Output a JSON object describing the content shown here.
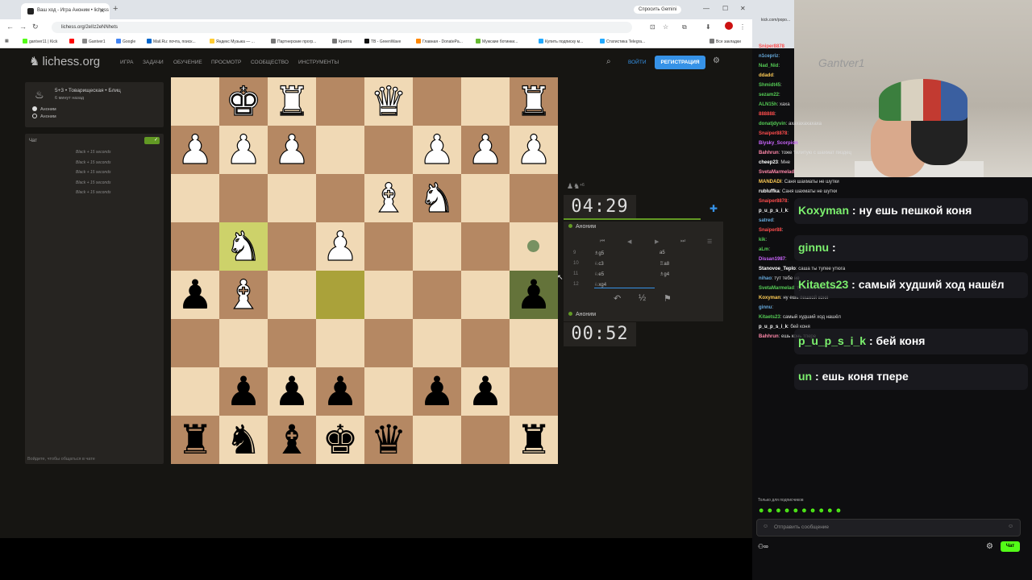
{
  "browser": {
    "tab_title": "Ваш ход - Игра Аноним • lichess",
    "gemini_label": "Спросить Gemini",
    "url": "lichess.org/2eIIz2eNNhets",
    "bookmarks": [
      "gantver11 | Kick",
      "Gantver1",
      "Google",
      "Mail.Ru: почта, поиск...",
      "Яндекс Музыка — ...",
      "Партнерские прогр...",
      "Криптa",
      "ТВ - GreenWave",
      "Главная - DonatePa...",
      "Мужские ботинки...",
      "Купить подписку м...",
      "Статистика Telegra...",
      "Все закладки"
    ]
  },
  "site": {
    "logo": "lichess.org",
    "nav": [
      "Игра",
      "Задачи",
      "Обучение",
      "Просмотр",
      "Сообщество",
      "Инструменты"
    ],
    "login": "ВОЙТИ",
    "register": "РЕГИСТРАЦИЯ"
  },
  "game_info": {
    "mode": "5+3 • Товарищеская • Блиц",
    "time_ago": "6 минут назад",
    "player_white": "Аноним",
    "player_black": "Аноним"
  },
  "lichess_chat": {
    "title": "Чат",
    "lines": [
      "Black + 15 seconds",
      "Black + 15 seconds",
      "Black + 15 seconds",
      "Black + 15 seconds",
      "Black + 15 seconds"
    ],
    "login_prompt": "Войдите, чтобы общаться в чате"
  },
  "board": {
    "pieces": [
      {
        "sq": "b8",
        "c": "w",
        "p": "♚"
      },
      {
        "sq": "c8",
        "c": "w",
        "p": "♜"
      },
      {
        "sq": "e8",
        "c": "w",
        "p": "♛"
      },
      {
        "sq": "h8",
        "c": "w",
        "p": "♜"
      },
      {
        "sq": "a7",
        "c": "w",
        "p": "♟"
      },
      {
        "sq": "b7",
        "c": "w",
        "p": "♟"
      },
      {
        "sq": "c7",
        "c": "w",
        "p": "♟"
      },
      {
        "sq": "f7",
        "c": "w",
        "p": "♟"
      },
      {
        "sq": "g7",
        "c": "w",
        "p": "♟"
      },
      {
        "sq": "h7",
        "c": "w",
        "p": "♟"
      },
      {
        "sq": "e6",
        "c": "w",
        "p": "♝"
      },
      {
        "sq": "f6",
        "c": "w",
        "p": "♞"
      },
      {
        "sq": "b5",
        "c": "w",
        "p": "♞"
      },
      {
        "sq": "d5",
        "c": "w",
        "p": "♟"
      },
      {
        "sq": "a4",
        "c": "b",
        "p": "♟"
      },
      {
        "sq": "b4",
        "c": "w",
        "p": "♝"
      },
      {
        "sq": "h4",
        "c": "b",
        "p": "♟"
      },
      {
        "sq": "b2",
        "c": "b",
        "p": "♟"
      },
      {
        "sq": "c2",
        "c": "b",
        "p": "♟"
      },
      {
        "sq": "d2",
        "c": "b",
        "p": "♟"
      },
      {
        "sq": "f2",
        "c": "b",
        "p": "♟"
      },
      {
        "sq": "g2",
        "c": "b",
        "p": "♟"
      },
      {
        "sq": "a1",
        "c": "b",
        "p": "♜"
      },
      {
        "sq": "b1",
        "c": "b",
        "p": "♞"
      },
      {
        "sq": "c1",
        "c": "b",
        "p": "♝"
      },
      {
        "sq": "d1",
        "c": "b",
        "p": "♚"
      },
      {
        "sq": "e1",
        "c": "b",
        "p": "♛"
      },
      {
        "sq": "h1",
        "c": "b",
        "p": "♜"
      }
    ],
    "highlights": [
      "b5",
      "d4"
    ],
    "check_square": "h4",
    "light_color": "#f0d9b5",
    "dark_color": "#b58863"
  },
  "clocks": {
    "top": "04:29",
    "bottom": "00:52",
    "top_player": "Аноним",
    "bottom_player": "Аноним",
    "material_diff": "+6"
  },
  "moves": [
    {
      "n": "9",
      "w": "♗g5",
      "b": "a5"
    },
    {
      "n": "10",
      "w": "♘c3",
      "b": "♖a8"
    },
    {
      "n": "11",
      "w": "♘e5",
      "b": "♗g4"
    },
    {
      "n": "12",
      "w": "♘xg4",
      "b": ""
    }
  ],
  "draw_label": "½",
  "twitch_chat": [
    {
      "u": "Sniper8878",
      "c": "#ff4d4d",
      "t": ""
    },
    {
      "u": "n1cepriz",
      "c": "#6ad",
      "t": ""
    },
    {
      "u": "Nad_Nid",
      "c": "#5c5",
      "t": ""
    },
    {
      "u": "ddadd",
      "c": "#fc5",
      "t": ""
    },
    {
      "u": "Shmidt45",
      "c": "#5c5",
      "t": ""
    },
    {
      "u": "sezam22",
      "c": "#5c5",
      "t": ""
    },
    {
      "u": "ALN15h",
      "c": "#5c5",
      "t": "хаха"
    },
    {
      "u": "888888",
      "c": "#ff4d4d",
      "t": ""
    },
    {
      "u": "donatjdyvin",
      "c": "#5c5",
      "t": "ахахахахахаха"
    },
    {
      "u": "Snaiper8878",
      "c": "#ff4d4d",
      "t": ""
    },
    {
      "u": "Biysky_Scorpion",
      "c": "#c6f",
      "t": ""
    },
    {
      "u": "Bahhrun",
      "c": "#f8a",
      "t": "тоже тилитую с шахмат пиздец"
    },
    {
      "u": "cheep23",
      "c": "#fff",
      "t": "Мне"
    },
    {
      "u": "SvetaMarmelad",
      "c": "#f8a",
      "t": ""
    },
    {
      "u": "MANDADI",
      "c": "#fc5",
      "t": "Саня шахматы не шутки"
    },
    {
      "u": "rubluffka",
      "c": "#fff",
      "t": "Саня шахматы не шутки"
    },
    {
      "u": "Snaiper8878",
      "c": "#ff4d4d",
      "t": ""
    },
    {
      "u": "p_u_p_s_i_k",
      "c": "#fff",
      "t": ""
    },
    {
      "u": "satred",
      "c": "#6ad",
      "t": ""
    },
    {
      "u": "Snaiper88",
      "c": "#ff4d4d",
      "t": ""
    },
    {
      "u": "kik",
      "c": "#5c5",
      "t": ""
    },
    {
      "u": "aLm",
      "c": "#5c5",
      "t": ""
    },
    {
      "u": "Dissan1987",
      "c": "#c6f",
      "t": ""
    },
    {
      "u": "Stanovoe_Teplo",
      "c": "#fff",
      "t": "саша ты тупее утюга"
    },
    {
      "u": "nihao",
      "c": "#6ad",
      "t": "тут тебе не"
    },
    {
      "u": "SvetaMarmelad",
      "c": "#5c5",
      "t": "тупо кмс по шашкам"
    },
    {
      "u": "Koxyman",
      "c": "#fc5",
      "t": "ну ешь пешкой коня"
    },
    {
      "u": "ginnu",
      "c": "#6ad",
      "t": ""
    },
    {
      "u": "Kitaets23",
      "c": "#5c5",
      "t": "самый худший ход нашёл"
    },
    {
      "u": "p_u_p_s_i_k",
      "c": "#fff",
      "t": "бей коня"
    },
    {
      "u": "Bahhrun",
      "c": "#f8a",
      "t": "ешь конь тпере"
    }
  ],
  "overlays": [
    {
      "u": "Koxyman",
      "t": "ну ешь пешкой коня"
    },
    {
      "u": "ginnu",
      "t": ""
    },
    {
      "u": "Kitaets23",
      "t": "самый худший ход нашёл"
    },
    {
      "u": "p_u_p_s_i_k",
      "t": "бей коня"
    },
    {
      "u": "un",
      "t": "ешь коня тпере"
    }
  ],
  "stream": {
    "tab_url": "kick.com/popo...",
    "webcam_label": "Gantver1",
    "sub_only": "Только для подписчиков",
    "send_placeholder": "Отправить сообщение",
    "chat_button": "Чат"
  }
}
